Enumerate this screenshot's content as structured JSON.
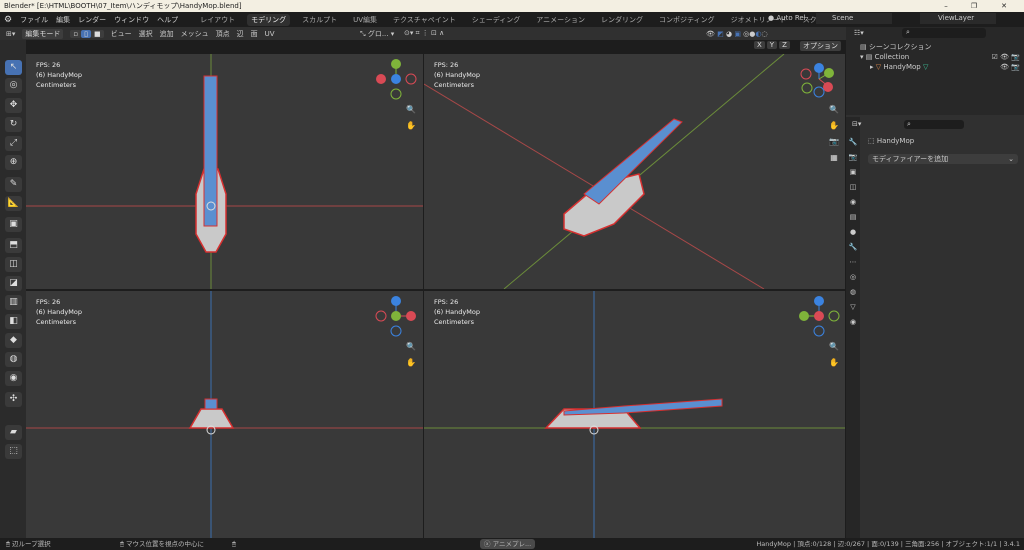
{
  "window": {
    "title": "Blender* [E:\\HTML\\BOOTH\\07_Item\\ハンディモップ\\HandyMop.blend]",
    "min": "–",
    "max": "❐",
    "close": "✕"
  },
  "menu": [
    "ファイル",
    "編集",
    "レンダー",
    "ウィンドウ",
    "ヘルプ"
  ],
  "workspaces": [
    "レイアウト",
    "モデリング",
    "スカルプト",
    "UV編集",
    "テクスチャペイント",
    "シェーディング",
    "アニメーション",
    "レンダリング",
    "コンポジティング",
    "ジオメトリノード",
    "スクリプト作成",
    "+"
  ],
  "active_workspace": "モデリング",
  "topright": {
    "auto_run": "Auto Rel...",
    "scene": "Scene",
    "view_layer": "ViewLayer"
  },
  "toolheader": {
    "mode": "編集モード",
    "menus": [
      "ビュー",
      "選択",
      "追加",
      "メッシュ",
      "頂点",
      "辺",
      "面",
      "UV"
    ],
    "transform": "グロ...",
    "options": "オプション",
    "axes": [
      "X",
      "Y",
      "Z"
    ]
  },
  "viewports": [
    {
      "fps": "FPS: 26",
      "object": "(6) HandyMop",
      "units": "Centimeters"
    },
    {
      "fps": "FPS: 26",
      "object": "(6) HandyMop",
      "units": "Centimeters"
    },
    {
      "fps": "FPS: 26",
      "object": "(6) HandyMop",
      "units": "Centimeters"
    },
    {
      "fps": "FPS: 26",
      "object": "(6) HandyMop",
      "units": "Centimeters"
    }
  ],
  "outliner": {
    "root": "シーンコレクション",
    "collection": "Collection",
    "object": "HandyMop"
  },
  "properties": {
    "object": "HandyMop",
    "add_modifier": "モディファイアーを追加"
  },
  "statusbar": {
    "left1": "辺ループ選択",
    "left2": "マウス位置を視点の中心に",
    "center": "アニメプレ...",
    "stats": "HandyMop | 頂点:0/128 | 辺:0/267 | 面:0/139 | 三角面:256 | オブジェクト:1/1 | 3.4.1"
  },
  "colors": {
    "accent": "#4772b3",
    "mesh": "#5a8fd0",
    "edge_red": "#d63030",
    "x_axis": "#d94a55",
    "y_axis": "#7fb43a",
    "z_axis": "#3b83e0"
  }
}
